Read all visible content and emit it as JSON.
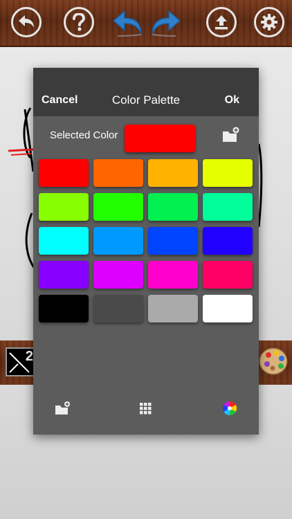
{
  "toolbar": {
    "buttons": [
      {
        "name": "back-button",
        "icon": "back-arrow-icon"
      },
      {
        "name": "help-button",
        "icon": "question-icon"
      },
      {
        "name": "undo-button",
        "icon": "undo-icon"
      },
      {
        "name": "redo-button",
        "icon": "redo-icon"
      },
      {
        "name": "upload-button",
        "icon": "upload-icon"
      },
      {
        "name": "settings-button",
        "icon": "gear-icon"
      }
    ]
  },
  "bottom_bar": {
    "brush_size": "2",
    "brush_icon": "brush-size-icon",
    "palette_icon": "palette-icon"
  },
  "dialog": {
    "cancel_label": "Cancel",
    "title": "Color Palette",
    "ok_label": "Ok",
    "selected_label": "Selected Color",
    "selected_color": "#ff0000",
    "swatches": [
      "#ff0000",
      "#ff6600",
      "#ffb300",
      "#e5ff00",
      "#88ff00",
      "#22ff00",
      "#00f050",
      "#00ff9a",
      "#00ffff",
      "#0099ff",
      "#0044ff",
      "#2200ff",
      "#8800ff",
      "#dd00ff",
      "#ff00cc",
      "#ff0066",
      "#000000",
      "#4a4a4a",
      "#aaaaaa",
      "#ffffff"
    ],
    "footer_icons": [
      "add-to-folder-icon",
      "grid-icon",
      "color-wheel-icon"
    ]
  }
}
